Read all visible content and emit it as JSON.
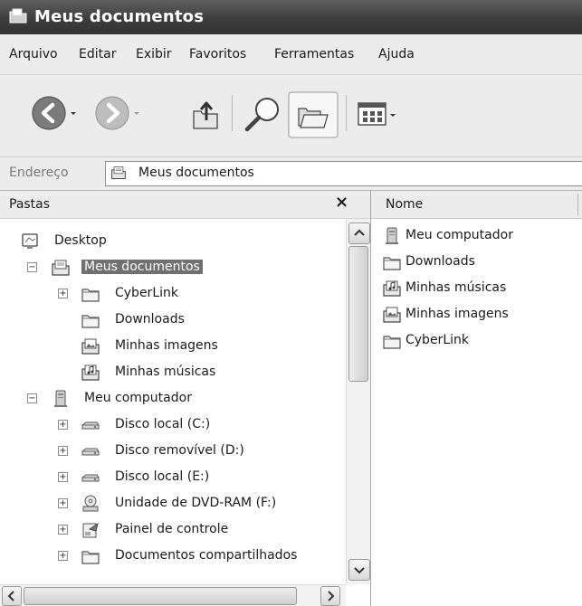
{
  "window": {
    "title": "Meus documentos"
  },
  "menu": [
    "Arquivo",
    "Editar",
    "Exibir",
    "Favoritos",
    "Ferramentas",
    "Ajuda"
  ],
  "address": {
    "label": "Endereço",
    "value": "Meus documentos"
  },
  "folders_pane": {
    "title": "Pastas",
    "close_glyph": "×",
    "tree": [
      {
        "label": "Desktop",
        "icon": "desktop-icon",
        "expander": ""
      },
      {
        "label": "Meus documentos",
        "icon": "my-documents-icon",
        "expander": "−",
        "selected": true
      },
      {
        "label": "CyberLink",
        "icon": "folder-icon",
        "expander": "+"
      },
      {
        "label": "Downloads",
        "icon": "folder-icon",
        "expander": ""
      },
      {
        "label": "Minhas imagens",
        "icon": "my-pictures-icon",
        "expander": ""
      },
      {
        "label": "Minhas músicas",
        "icon": "my-music-icon",
        "expander": ""
      },
      {
        "label": "Meu computador",
        "icon": "my-computer-icon",
        "expander": "−"
      },
      {
        "label": "Disco local (C:)",
        "icon": "hard-disk-icon",
        "expander": "+"
      },
      {
        "label": "Disco removível (D:)",
        "icon": "removable-disk-icon",
        "expander": "+"
      },
      {
        "label": "Disco local (E:)",
        "icon": "hard-disk-icon",
        "expander": "+"
      },
      {
        "label": "Unidade de DVD-RAM (F:)",
        "icon": "dvd-drive-icon",
        "expander": "+"
      },
      {
        "label": "Painel de controle",
        "icon": "control-panel-icon",
        "expander": "+"
      },
      {
        "label": "Documentos compartilhados",
        "icon": "folder-icon",
        "expander": "+"
      }
    ]
  },
  "files_pane": {
    "column": "Nome",
    "items": [
      {
        "label": "Meu computador",
        "icon": "my-computer-shortcut-icon"
      },
      {
        "label": "Downloads",
        "icon": "folder-icon"
      },
      {
        "label": "Minhas músicas",
        "icon": "my-music-icon"
      },
      {
        "label": "Minhas imagens",
        "icon": "my-pictures-icon"
      },
      {
        "label": "CyberLink",
        "icon": "folder-icon"
      }
    ]
  }
}
